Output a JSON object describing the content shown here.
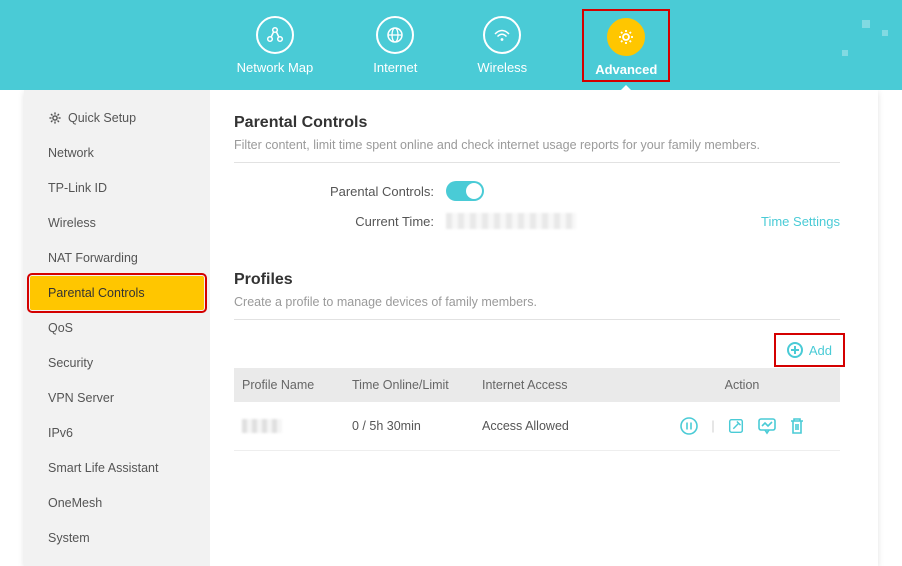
{
  "nav": {
    "items": [
      {
        "label": "Network Map"
      },
      {
        "label": "Internet"
      },
      {
        "label": "Wireless"
      },
      {
        "label": "Advanced"
      }
    ],
    "activeIndex": 3
  },
  "sidebar": {
    "items": [
      {
        "label": "Quick Setup",
        "quick": true
      },
      {
        "label": "Network"
      },
      {
        "label": "TP-Link ID"
      },
      {
        "label": "Wireless"
      },
      {
        "label": "NAT Forwarding"
      },
      {
        "label": "Parental Controls",
        "selected": true
      },
      {
        "label": "QoS"
      },
      {
        "label": "Security"
      },
      {
        "label": "VPN Server"
      },
      {
        "label": "IPv6"
      },
      {
        "label": "Smart Life Assistant"
      },
      {
        "label": "OneMesh"
      },
      {
        "label": "System"
      }
    ]
  },
  "parental": {
    "title": "Parental Controls",
    "desc": "Filter content, limit time spent online and check internet usage reports for your family members.",
    "toggle_label": "Parental Controls:",
    "toggle_on": true,
    "time_label": "Current Time:",
    "time_value": "",
    "time_settings_link": "Time Settings"
  },
  "profiles": {
    "title": "Profiles",
    "desc": "Create a profile to manage devices of family members.",
    "add_label": "Add",
    "columns": {
      "name": "Profile Name",
      "time": "Time Online/Limit",
      "access": "Internet Access",
      "action": "Action"
    },
    "rows": [
      {
        "name": "",
        "time": "0 / 5h 30min",
        "access": "Access Allowed"
      }
    ]
  },
  "colors": {
    "accent": "#4acbd6",
    "warn": "#ffc600",
    "highlight": "#d40000"
  }
}
